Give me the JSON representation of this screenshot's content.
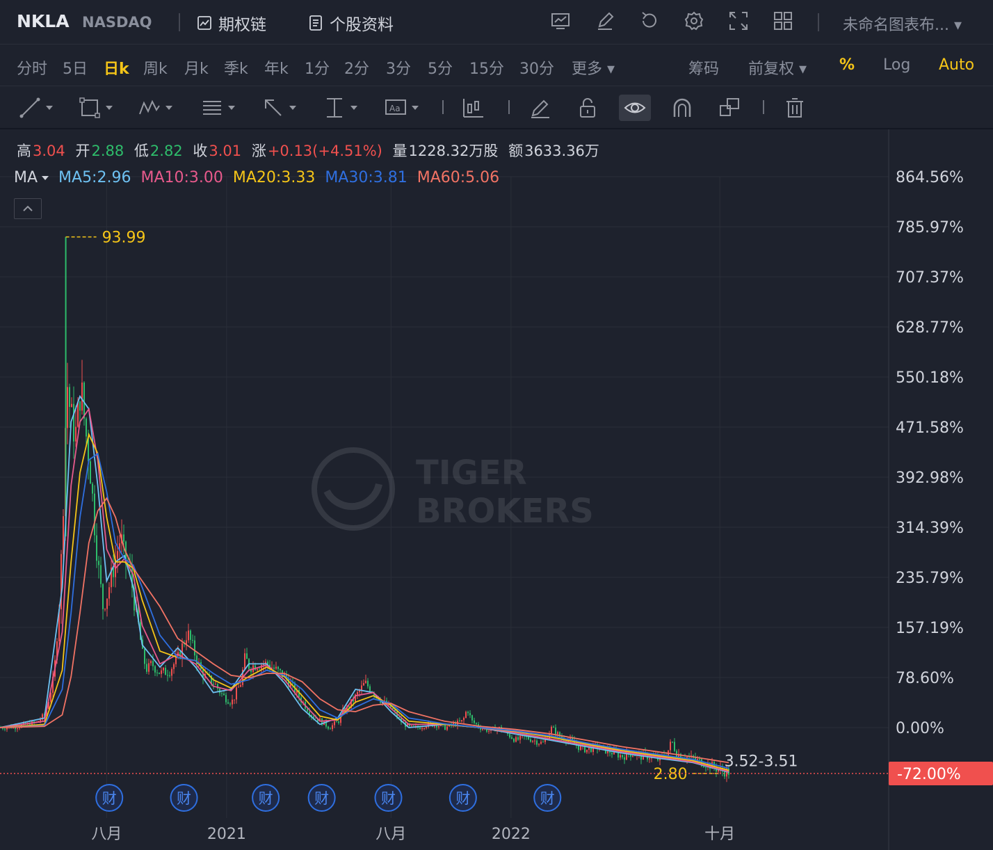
{
  "header": {
    "symbol": "NKLA",
    "exchange": "NASDAQ",
    "option_chain_label": "期权链",
    "profile_label": "个股资料",
    "chart_name": "未命名图表布..."
  },
  "periods": {
    "items": [
      "分时",
      "5日",
      "日k",
      "周k",
      "月k",
      "季k",
      "年k",
      "1分",
      "2分",
      "3分",
      "5分",
      "15分",
      "30分",
      "更多"
    ],
    "active": "日k",
    "chips_label": "筹码",
    "adjust_label": "前复权",
    "percent_label": "%",
    "log_label": "Log",
    "auto_label": "Auto"
  },
  "quote": {
    "high_label": "高",
    "high": "3.04",
    "open_label": "开",
    "open": "2.88",
    "low_label": "低",
    "low": "2.82",
    "close_label": "收",
    "close": "3.01",
    "change_label": "涨",
    "change": "+0.13(+4.51%)",
    "volume_label": "量",
    "volume": "1228.32万股",
    "amount_label": "额",
    "amount": "3633.36万"
  },
  "ma_legend": {
    "label": "MA",
    "items": [
      {
        "text": "MA5:2.96",
        "color": "#6ec1f2"
      },
      {
        "text": "MA10:3.00",
        "color": "#e85a8c"
      },
      {
        "text": "MA20:3.33",
        "color": "#f5c518"
      },
      {
        "text": "MA30:3.81",
        "color": "#2f6fe0"
      },
      {
        "text": "MA60:5.06",
        "color": "#f27364"
      }
    ]
  },
  "chart_data": {
    "type": "line",
    "y_ticks": [
      "864.56%",
      "785.97%",
      "707.37%",
      "628.77%",
      "550.18%",
      "471.58%",
      "392.98%",
      "314.39%",
      "235.79%",
      "157.19%",
      "78.60%",
      "0.00%"
    ],
    "y_tick_values": [
      864.56,
      785.97,
      707.37,
      628.77,
      550.18,
      471.58,
      392.98,
      314.39,
      235.79,
      157.19,
      78.6,
      0.0
    ],
    "x_ticks": [
      "八月",
      "2021",
      "八月",
      "2022",
      "十月"
    ],
    "x_tick_positions": [
      0.12,
      0.255,
      0.44,
      0.575,
      0.81
    ],
    "current_value_label": "-72.00%",
    "current_value": -72.0,
    "high_annotation": "93.99",
    "high_value_pct": 770,
    "low_annotation": "2.80",
    "range_annotation": "3.52-3.51",
    "earnings_marker_label": "财",
    "earnings_marker_positions": [
      0.123,
      0.207,
      0.299,
      0.362,
      0.437,
      0.521,
      0.616
    ],
    "colors": {
      "up": "#f0504e",
      "down": "#2ebd6b"
    },
    "price_series": {
      "x": [
        0.0,
        0.02,
        0.04,
        0.05,
        0.06,
        0.067,
        0.072,
        0.074,
        0.076,
        0.08,
        0.085,
        0.09,
        0.095,
        0.1,
        0.105,
        0.11,
        0.115,
        0.12,
        0.125,
        0.13,
        0.135,
        0.14,
        0.145,
        0.15,
        0.155,
        0.16,
        0.165,
        0.17,
        0.18,
        0.19,
        0.2,
        0.21,
        0.22,
        0.225,
        0.23,
        0.24,
        0.25,
        0.26,
        0.27,
        0.275,
        0.28,
        0.29,
        0.3,
        0.31,
        0.32,
        0.33,
        0.34,
        0.35,
        0.36,
        0.37,
        0.38,
        0.385,
        0.39,
        0.4,
        0.41,
        0.42,
        0.43,
        0.44,
        0.45,
        0.46,
        0.47,
        0.48,
        0.49,
        0.5,
        0.51,
        0.52,
        0.525,
        0.53,
        0.54,
        0.55,
        0.56,
        0.57,
        0.58,
        0.59,
        0.6,
        0.61,
        0.62,
        0.63,
        0.64,
        0.645,
        0.65,
        0.66,
        0.67,
        0.68,
        0.69,
        0.7,
        0.71,
        0.72,
        0.73,
        0.74,
        0.75,
        0.755,
        0.76,
        0.77,
        0.78,
        0.79,
        0.8,
        0.81,
        0.82
      ],
      "y": [
        0,
        2,
        8,
        20,
        80,
        220,
        420,
        560,
        520,
        480,
        460,
        540,
        470,
        420,
        330,
        250,
        190,
        210,
        240,
        270,
        300,
        260,
        250,
        200,
        160,
        110,
        90,
        100,
        85,
        90,
        110,
        150,
        110,
        90,
        80,
        70,
        50,
        40,
        70,
        110,
        95,
        100,
        100,
        90,
        80,
        60,
        40,
        20,
        10,
        0,
        10,
        25,
        30,
        50,
        70,
        55,
        40,
        30,
        10,
        0,
        0,
        5,
        5,
        0,
        5,
        10,
        30,
        10,
        0,
        -5,
        0,
        -10,
        -20,
        -15,
        -20,
        -25,
        0,
        -15,
        -20,
        -25,
        -30,
        -35,
        -30,
        -35,
        -40,
        -45,
        -40,
        -45,
        -45,
        -50,
        -40,
        -20,
        -40,
        -45,
        -50,
        -55,
        -60,
        -68,
        -70
      ]
    },
    "ma_series": [
      {
        "name": "MA5",
        "color": "#6ec1f2",
        "x": [
          0.0,
          0.05,
          0.07,
          0.08,
          0.09,
          0.1,
          0.11,
          0.12,
          0.13,
          0.14,
          0.15,
          0.16,
          0.18,
          0.2,
          0.22,
          0.24,
          0.26,
          0.28,
          0.3,
          0.32,
          0.34,
          0.36,
          0.38,
          0.4,
          0.42,
          0.44,
          0.46,
          0.5,
          0.54,
          0.58,
          0.62,
          0.66,
          0.7,
          0.74,
          0.78,
          0.82
        ],
        "y": [
          0,
          15,
          220,
          480,
          520,
          500,
          380,
          230,
          260,
          270,
          220,
          130,
          95,
          125,
          95,
          55,
          60,
          100,
          100,
          70,
          30,
          5,
          15,
          60,
          55,
          25,
          0,
          5,
          0,
          -10,
          -20,
          -30,
          -40,
          -48,
          -55,
          -70
        ]
      },
      {
        "name": "MA10",
        "color": "#e85a8c",
        "x": [
          0.0,
          0.05,
          0.07,
          0.08,
          0.09,
          0.1,
          0.11,
          0.12,
          0.13,
          0.14,
          0.15,
          0.16,
          0.18,
          0.2,
          0.22,
          0.24,
          0.26,
          0.28,
          0.3,
          0.32,
          0.34,
          0.36,
          0.38,
          0.4,
          0.42,
          0.44,
          0.46,
          0.5,
          0.54,
          0.58,
          0.62,
          0.66,
          0.7,
          0.74,
          0.78,
          0.82
        ],
        "y": [
          0,
          10,
          150,
          380,
          480,
          500,
          420,
          280,
          250,
          265,
          240,
          160,
          100,
          115,
          100,
          65,
          58,
          90,
          98,
          75,
          40,
          10,
          12,
          50,
          55,
          30,
          5,
          5,
          0,
          -8,
          -18,
          -28,
          -38,
          -46,
          -54,
          -69
        ]
      },
      {
        "name": "MA20",
        "color": "#f5c518",
        "x": [
          0.0,
          0.05,
          0.07,
          0.08,
          0.09,
          0.1,
          0.11,
          0.12,
          0.13,
          0.14,
          0.15,
          0.16,
          0.18,
          0.2,
          0.22,
          0.24,
          0.26,
          0.28,
          0.3,
          0.32,
          0.34,
          0.36,
          0.38,
          0.4,
          0.42,
          0.44,
          0.46,
          0.5,
          0.54,
          0.58,
          0.62,
          0.66,
          0.7,
          0.74,
          0.78,
          0.82
        ],
        "y": [
          0,
          5,
          90,
          260,
          400,
          460,
          430,
          330,
          260,
          260,
          250,
          200,
          120,
          110,
          105,
          75,
          62,
          80,
          95,
          80,
          50,
          18,
          12,
          40,
          50,
          35,
          10,
          5,
          0,
          -6,
          -15,
          -26,
          -36,
          -44,
          -52,
          -67
        ]
      },
      {
        "name": "MA30",
        "color": "#2f6fe0",
        "x": [
          0.0,
          0.05,
          0.07,
          0.08,
          0.09,
          0.1,
          0.11,
          0.12,
          0.13,
          0.14,
          0.15,
          0.16,
          0.18,
          0.2,
          0.22,
          0.24,
          0.26,
          0.28,
          0.3,
          0.32,
          0.34,
          0.36,
          0.38,
          0.4,
          0.42,
          0.44,
          0.46,
          0.5,
          0.54,
          0.58,
          0.62,
          0.66,
          0.7,
          0.74,
          0.78,
          0.82
        ],
        "y": [
          0,
          3,
          60,
          180,
          330,
          420,
          430,
          370,
          290,
          265,
          255,
          220,
          145,
          110,
          105,
          85,
          68,
          75,
          90,
          82,
          60,
          28,
          15,
          32,
          45,
          38,
          15,
          6,
          0,
          -5,
          -13,
          -24,
          -34,
          -42,
          -50,
          -64
        ]
      },
      {
        "name": "MA60",
        "color": "#f27364",
        "x": [
          0.0,
          0.05,
          0.07,
          0.08,
          0.09,
          0.1,
          0.11,
          0.12,
          0.13,
          0.14,
          0.15,
          0.16,
          0.18,
          0.2,
          0.22,
          0.24,
          0.26,
          0.28,
          0.3,
          0.32,
          0.34,
          0.36,
          0.38,
          0.4,
          0.42,
          0.44,
          0.46,
          0.5,
          0.54,
          0.58,
          0.62,
          0.66,
          0.7,
          0.74,
          0.78,
          0.82
        ],
        "y": [
          0,
          2,
          20,
          80,
          180,
          290,
          340,
          360,
          330,
          280,
          250,
          230,
          190,
          140,
          120,
          100,
          82,
          78,
          85,
          85,
          72,
          45,
          28,
          25,
          35,
          38,
          25,
          10,
          2,
          -3,
          -10,
          -20,
          -30,
          -38,
          -46,
          -55
        ]
      }
    ]
  }
}
